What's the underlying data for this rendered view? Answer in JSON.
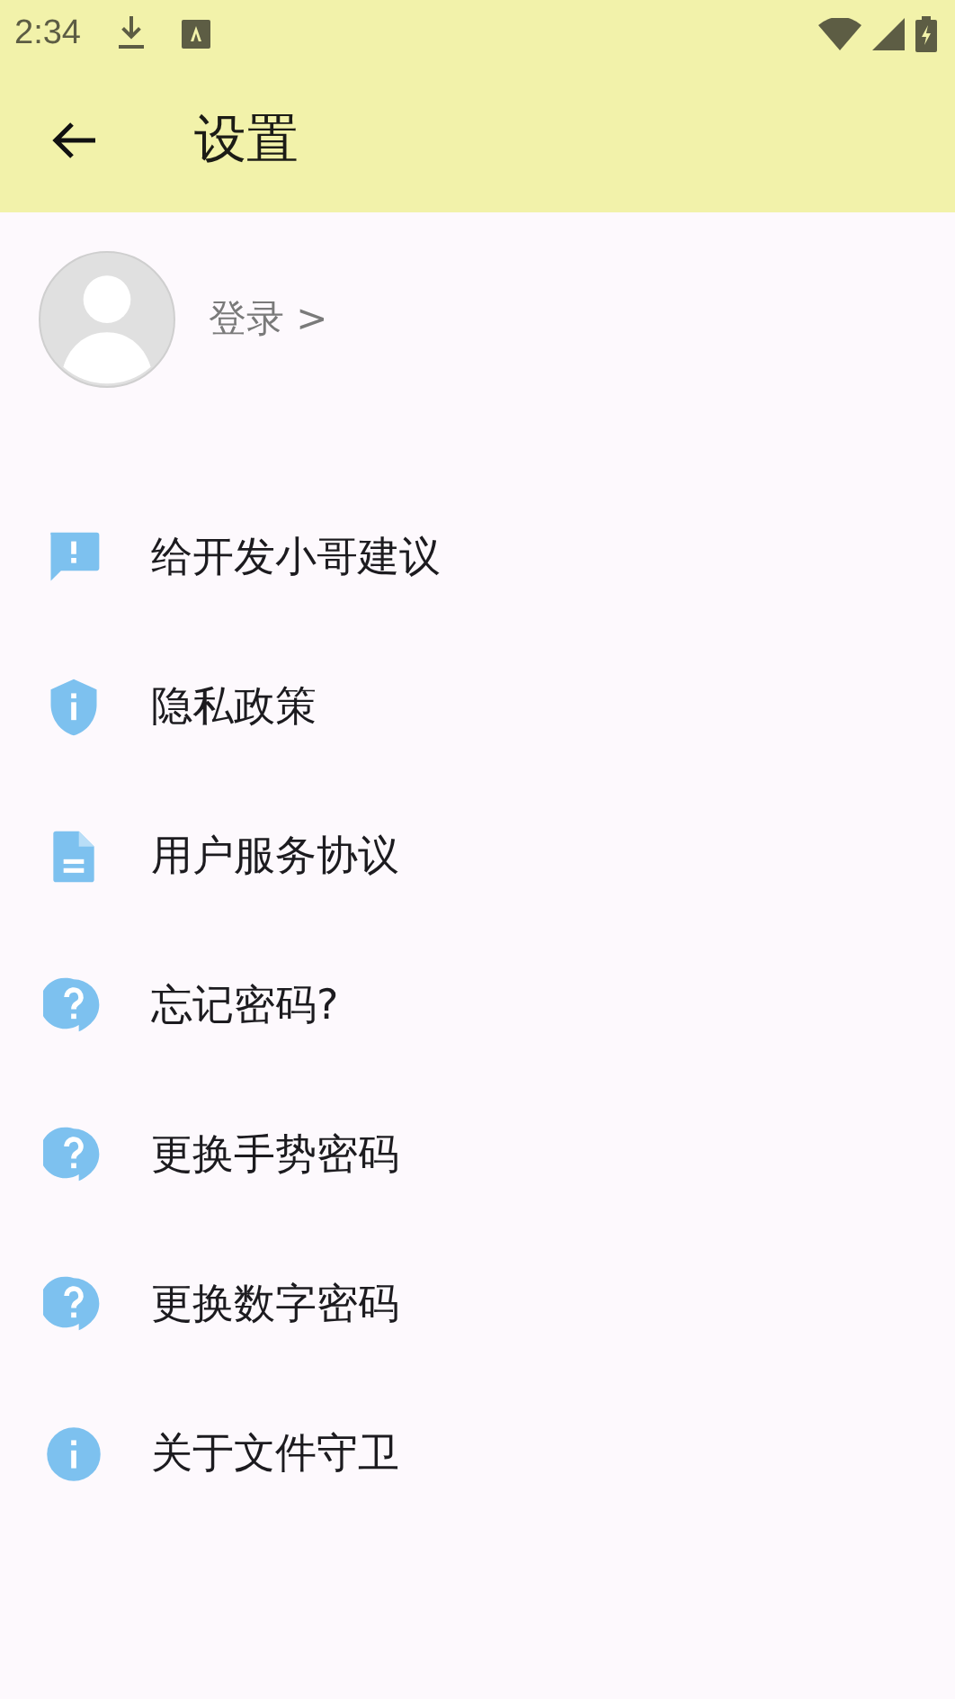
{
  "status_bar": {
    "time": "2:34"
  },
  "app_bar": {
    "title": "设置"
  },
  "profile": {
    "login": "登录 >"
  },
  "items": [
    {
      "kind": "feedback",
      "label": "给开发小哥建议"
    },
    {
      "kind": "shield",
      "label": "隐私政策"
    },
    {
      "kind": "document",
      "label": "用户服务协议"
    },
    {
      "kind": "help",
      "label": "忘记密码?"
    },
    {
      "kind": "help",
      "label": "更换手势密码"
    },
    {
      "kind": "help",
      "label": "更换数字密码"
    },
    {
      "kind": "info",
      "label": "关于文件守卫"
    }
  ]
}
